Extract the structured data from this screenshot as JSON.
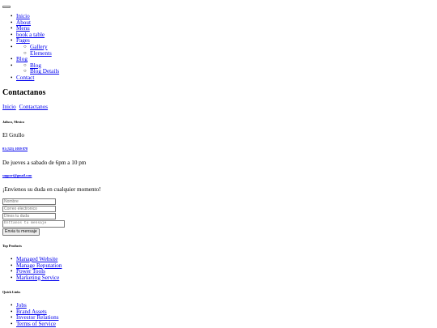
{
  "nav": {
    "items": [
      {
        "label": "Inicio"
      },
      {
        "label": "About"
      },
      {
        "label": "Menu"
      },
      {
        "label": "book a table"
      },
      {
        "label": "Pages",
        "children": [
          {
            "label": "Gallery"
          },
          {
            "label": "Elements"
          }
        ]
      },
      {
        "label": "Blog",
        "children": [
          {
            "label": "Blog"
          },
          {
            "label": "Blog Details"
          }
        ]
      },
      {
        "label": "Contact"
      }
    ]
  },
  "page": {
    "title": "Contactanos",
    "breadcrumb": [
      "Inicio",
      "Contactanos"
    ]
  },
  "contact": {
    "location_label": "Jalisco, Mexico",
    "location_text": "El Grullo",
    "phone_label": "01 (321) 1039 878",
    "hours_text": "De jueves a sabado de 6pm a 10 pm",
    "email_label": "support@gmail.com",
    "email_text": "¡Envienos su duda en cualquier momento!"
  },
  "form": {
    "name_placeholder": "Nombre",
    "email_placeholder": "Correo electronico",
    "subject_placeholder": "Dinos tu duda",
    "message_placeholder": "Enttanos tu mensaje",
    "submit_label": "Envia tu mensaje"
  },
  "footer": {
    "top_products": {
      "heading": "Top Products",
      "items": [
        "Managed Website",
        "Manage Reputation",
        "Power Tools",
        "Marketing Service"
      ]
    },
    "quick_links": {
      "heading": "Quick Links",
      "items": [
        "Jobs",
        "Brand Assets",
        "Investor Relations",
        "Terms of Service"
      ]
    }
  }
}
